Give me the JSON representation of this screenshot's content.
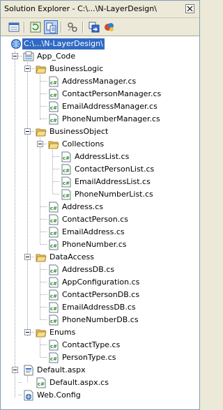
{
  "window": {
    "title": "Solution Explorer - C:\\...\\N-LayerDesign\\"
  },
  "toolbar": {
    "buttons": [
      {
        "name": "properties-icon"
      },
      {
        "name": "show-all-files-icon"
      },
      {
        "name": "refresh-icon"
      },
      {
        "name": "nest-related-files-icon"
      },
      {
        "name": "copy-website-icon"
      },
      {
        "name": "asp-net-configuration-icon"
      }
    ]
  },
  "tree": {
    "root": "C:\\...\\N-LayerDesign\\",
    "app_code": "App_Code",
    "business_logic": {
      "label": "BusinessLogic",
      "files": [
        "AddressManager.cs",
        "ContactPersonManager.cs",
        "EmailAddressManager.cs",
        "PhoneNumberManager.cs"
      ]
    },
    "business_object": {
      "label": "BusinessObject",
      "collections": {
        "label": "Collections",
        "files": [
          "AddressList.cs",
          "ContactPersonList.cs",
          "EmailAddressList.cs",
          "PhoneNumberList.cs"
        ]
      },
      "files": [
        "Address.cs",
        "ContactPerson.cs",
        "EmailAddress.cs",
        "PhoneNumber.cs"
      ]
    },
    "data_access": {
      "label": "DataAccess",
      "files": [
        "AddressDB.cs",
        "AppConfiguration.cs",
        "ContactPersonDB.cs",
        "EmailAddressDB.cs",
        "PhoneNumberDB.cs"
      ]
    },
    "enums": {
      "label": "Enums",
      "files": [
        "ContactType.cs",
        "PersonType.cs"
      ]
    },
    "default_aspx": "Default.aspx",
    "default_aspx_cs": "Default.aspx.cs",
    "web_config": "Web.Config"
  }
}
